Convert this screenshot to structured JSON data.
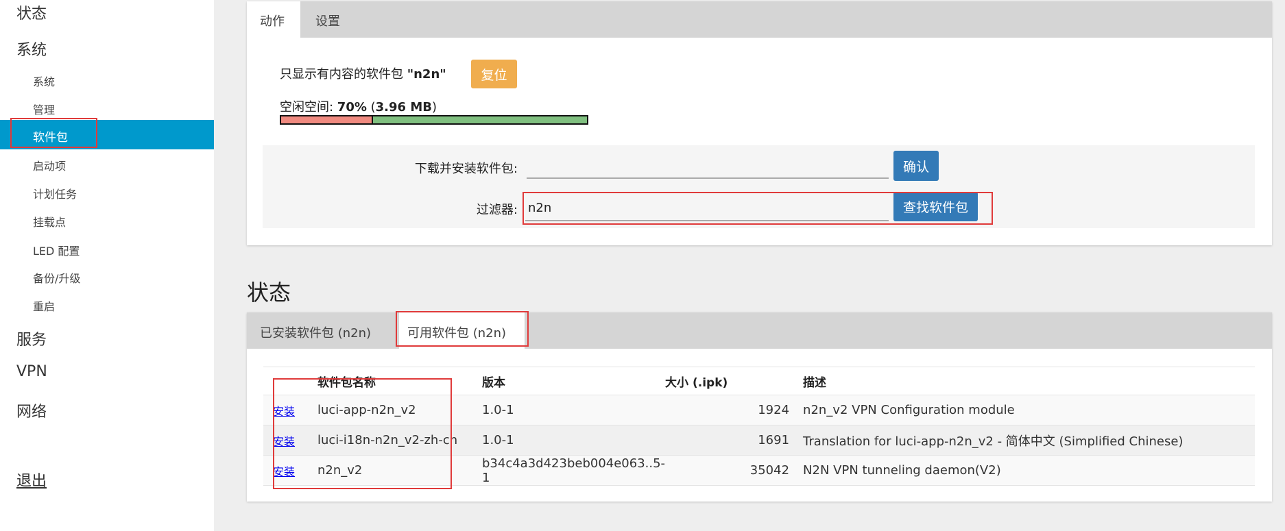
{
  "sidebar": {
    "status": "状态",
    "system": "系统",
    "system_items": [
      "系统",
      "管理",
      "软件包",
      "启动项",
      "计划任务",
      "挂载点",
      "LED 配置",
      "备份/升级",
      "重启"
    ],
    "services": "服务",
    "vpn": "VPN",
    "network": "网络",
    "logout": "退出"
  },
  "actions_panel": {
    "tabs": [
      "动作",
      "设置"
    ],
    "filter_notice_prefix": "只显示有内容的软件包",
    "filter_notice_value": "\"n2n\"",
    "reset_button": "复位",
    "free_space_label": "空闲空间: ",
    "free_space_percent": "70%",
    "free_space_size": "3.96 MB",
    "usage_fraction": 0.3,
    "download_label": "下载并安装软件包:",
    "download_value": "",
    "confirm_button": "确认",
    "filter_label": "过滤器:",
    "filter_value": "n2n",
    "find_button": "查找软件包"
  },
  "status_section": {
    "title": "状态",
    "tabs": [
      "已安装软件包 (n2n)",
      "可用软件包 (n2n)"
    ],
    "columns": [
      "软件包名称",
      "版本",
      "大小 (.ipk)",
      "描述"
    ],
    "install_label": "安装",
    "rows": [
      {
        "name": "luci-app-n2n_v2",
        "version": "1.0-1",
        "size": "1924",
        "desc": "n2n_v2 VPN Configuration module"
      },
      {
        "name": "luci-i18n-n2n_v2-zh-cn",
        "version": "1.0-1",
        "size": "1691",
        "desc": "Translation for luci-app-n2n_v2 - 简体中文 (Simplified Chinese)"
      },
      {
        "name": "n2n_v2",
        "version": "b34c4a3d423beb004e063..5-1",
        "size": "35042",
        "desc": "N2N VPN tunneling daemon(V2)"
      }
    ]
  },
  "colors": {
    "accent": "#0099cc",
    "reset_button": "#f0ad4e",
    "primary_button": "#337ab7",
    "used_space": "#f08a80",
    "free_space": "#80c080",
    "highlight": "#e03a3a"
  }
}
